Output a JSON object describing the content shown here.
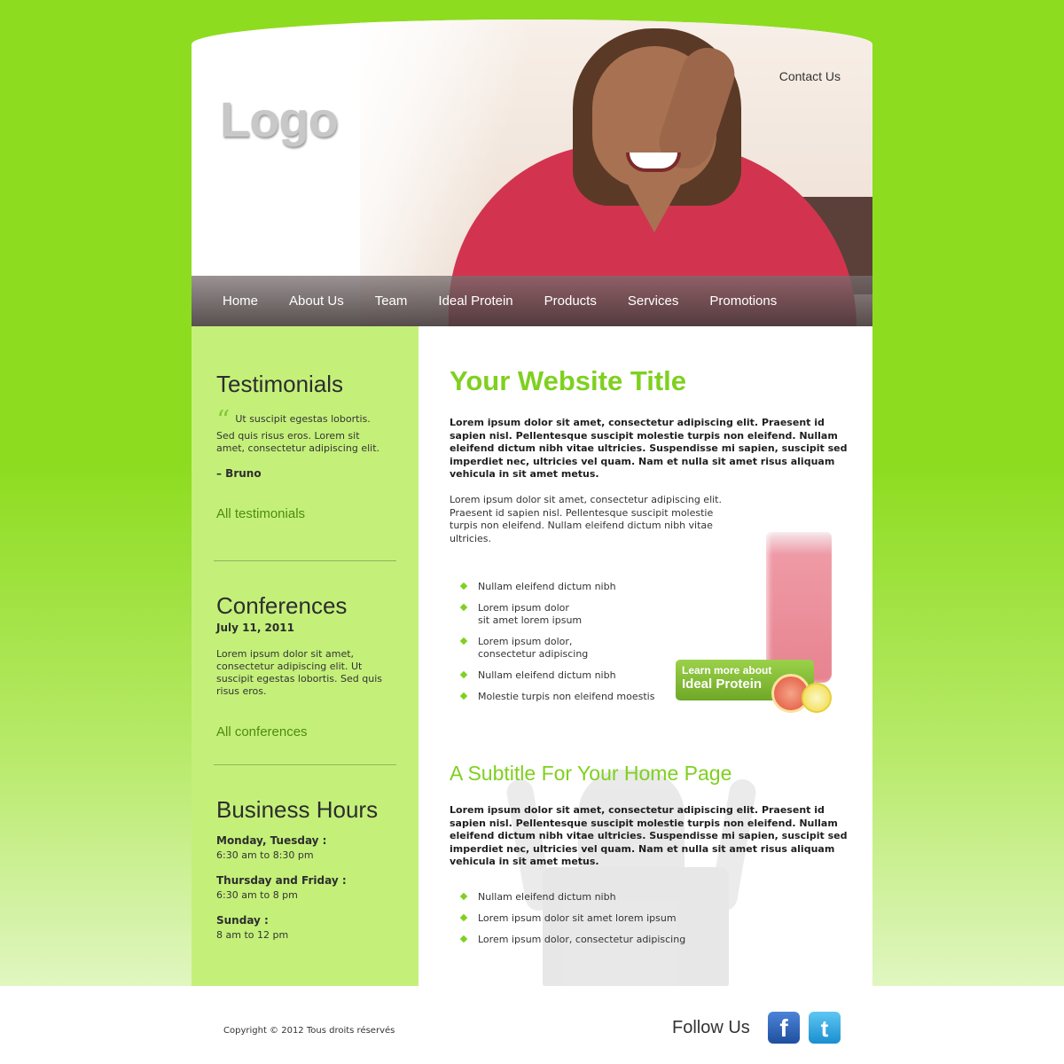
{
  "header": {
    "logo_text": "Logo",
    "contact_link": "Contact Us"
  },
  "nav": {
    "items": [
      "Home",
      "About Us",
      "Team",
      "Ideal Protein",
      "Products",
      "Services",
      "Promotions"
    ]
  },
  "sidebar": {
    "testimonials": {
      "title": "Testimonials",
      "quote_mark": "“",
      "quote": "Ut suscipit egestas lobortis. Sed quis risus eros. Lorem sit amet, consectetur adipiscing elit.",
      "author": "– Bruno",
      "link": "All testimonials"
    },
    "conferences": {
      "title": "Conferences",
      "date": "July 11, 2011",
      "text": "Lorem ipsum dolor sit amet, consectetur adipiscing elit. Ut suscipit egestas lobortis. Sed quis risus eros.",
      "link": "All conferences"
    },
    "hours": {
      "title": "Business Hours",
      "entries": [
        {
          "days": "Monday, Tuesday :",
          "time": "6:30 am to 8:30 pm"
        },
        {
          "days": "Thursday and Friday :",
          "time": "6:30 am to 8 pm"
        },
        {
          "days": "Sunday :",
          "time": "8 am to 12 pm"
        }
      ]
    }
  },
  "main": {
    "title": "Your Website Title",
    "intro_bold": "Lorem ipsum dolor sit amet, consectetur adipiscing elit. Praesent id sapien nisl. Pellentesque suscipit molestie turpis non eleifend. Nullam eleifend dictum nibh vitae ultricies. Suspendisse mi sapien, suscipit sed imperdiet nec, ultricies vel quam. Nam et nulla sit amet risus aliquam vehicula in sit amet metus.",
    "intro_text": "Lorem ipsum dolor sit amet, consectetur adipiscing elit. Praesent id sapien nisl. Pellentesque suscipit molestie turpis non eleifend. Nullam eleifend dictum nibh vitae ultricies.",
    "bullets": [
      "Nullam eleifend dictum nibh",
      "Lorem ipsum dolor\nsit amet lorem ipsum",
      "Lorem ipsum dolor,\nconsectetur adipiscing",
      "Nullam eleifend dictum nibh",
      "Molestie turpis non eleifend moestis"
    ],
    "promo": {
      "line1": "Learn more about",
      "line2": "Ideal Protein"
    },
    "subtitle": "A Subtitle For Your Home Page",
    "sub_bold": "Lorem ipsum dolor sit amet, consectetur adipiscing elit. Praesent id sapien nisl. Pellentesque suscipit molestie turpis non eleifend. Nullam eleifend dictum nibh vitae ultricies. Suspendisse mi sapien, suscipit sed imperdiet nec, ultricies vel quam. Nam et nulla sit amet risus aliquam vehicula in sit amet metus.",
    "sub_bullets": [
      "Nullam eleifend dictum nibh",
      "Lorem ipsum dolor sit amet lorem ipsum",
      "Lorem ipsum dolor, consectetur adipiscing"
    ]
  },
  "footer": {
    "copyright": "Copyright © 2012 Tous droits réservés",
    "follow": "Follow Us",
    "facebook_glyph": "f",
    "twitter_glyph": "t"
  },
  "colors": {
    "page_background": "#8ddc1f",
    "accent_green": "#7fd01f",
    "sidebar_green": "#c4f07a",
    "link_green": "#4f8a10"
  }
}
